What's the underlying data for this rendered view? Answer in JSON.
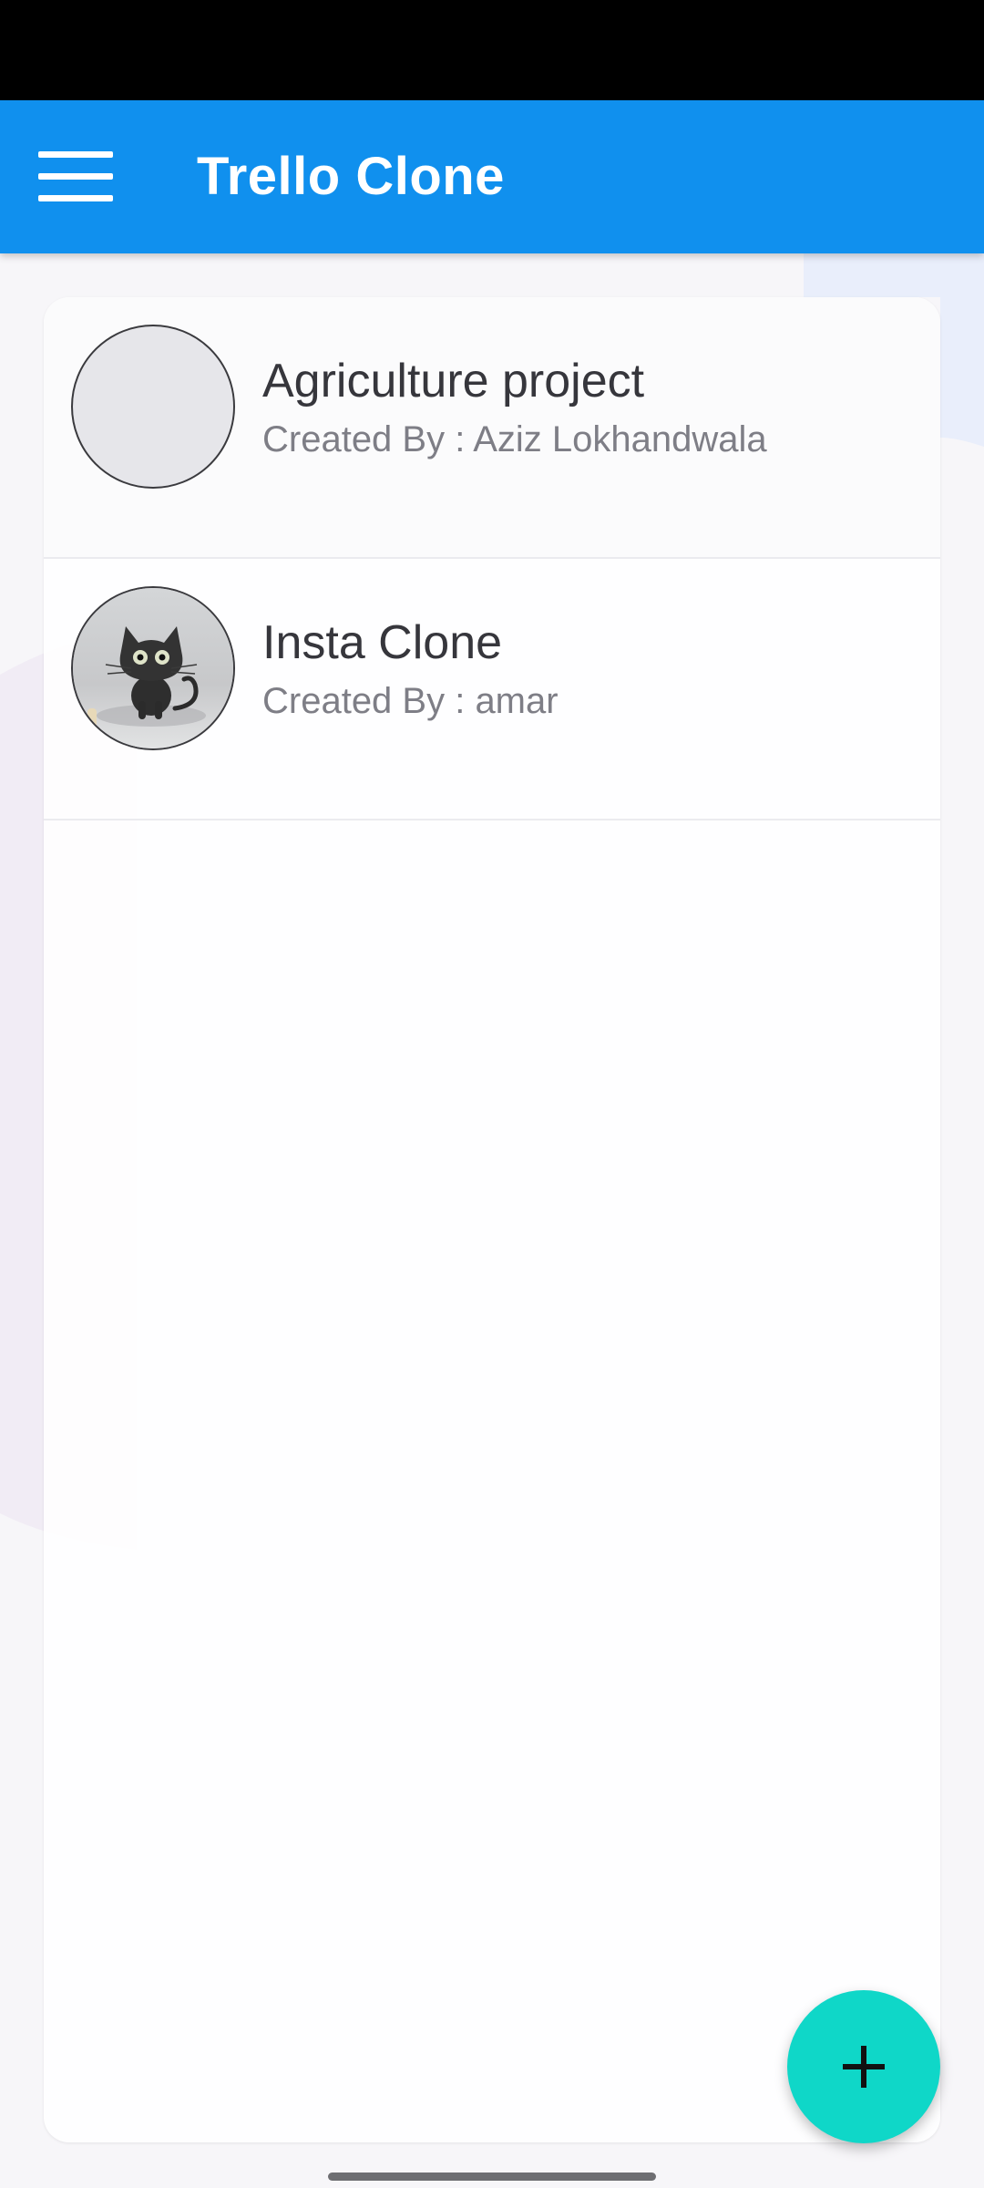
{
  "app": {
    "title": "Trello Clone",
    "menu_icon": "hamburger-menu-icon",
    "colors": {
      "app_bar": "#1090ee",
      "fab": "#0fd7c8",
      "title_text": "#ffffff"
    }
  },
  "boards": [
    {
      "name": "Agriculture project",
      "creator": "Created By : Aziz Lokhandwala",
      "avatar": "placeholder-avatar"
    },
    {
      "name": "Insta Clone",
      "creator": "Created By : amar",
      "avatar": "cat-avatar"
    }
  ],
  "fab": {
    "icon": "plus-icon"
  }
}
